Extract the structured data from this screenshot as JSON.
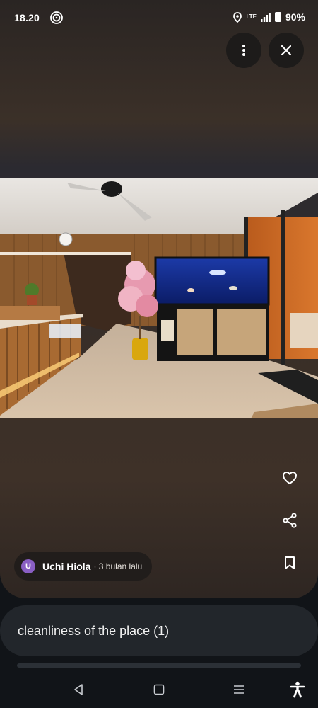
{
  "status_bar": {
    "time": "18.20",
    "network": "LTE",
    "battery": "90%"
  },
  "author": {
    "initial": "U",
    "name": "Uchi Hiola",
    "meta": "· 3 bulan lalu",
    "avatar_color": "#8a5fc4"
  },
  "topic": {
    "label": "cleanliness of the place (1)"
  },
  "colors": {
    "viewer_bg": "#3a2f27",
    "chip_bg": "#211d1b",
    "sheet_bg": "#22262b"
  },
  "icons": {
    "more": "more-vertical-icon",
    "close": "close-icon",
    "like": "heart-icon",
    "share": "share-icon",
    "save": "bookmark-icon"
  }
}
